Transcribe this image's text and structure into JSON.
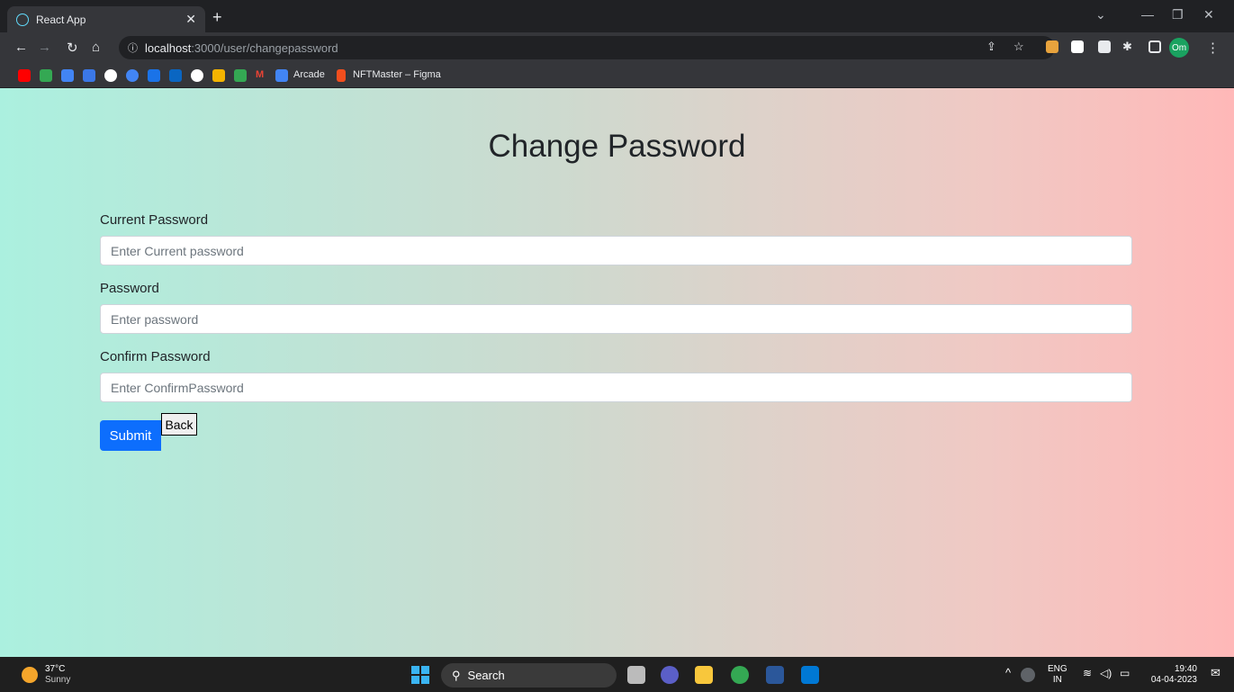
{
  "browser": {
    "tab_title": "React App",
    "url_host": "localhost",
    "url_path": ":3000/user/changepassword",
    "profile_initials": "Om",
    "bookmarks": [
      "Arcade",
      "NFTMaster – Figma"
    ]
  },
  "page": {
    "title": "Change Password",
    "current_label": "Current Password",
    "current_placeholder": "Enter Current password",
    "password_label": "Password",
    "password_placeholder": "Enter password",
    "confirm_label": "Confirm Password",
    "confirm_placeholder": "Enter ConfirmPassword",
    "submit_label": "Submit",
    "back_label": "Back"
  },
  "taskbar": {
    "temperature": "37°C",
    "weather": "Sunny",
    "search_label": "Search",
    "lang": "ENG",
    "region": "IN",
    "time": "19:40",
    "date": "04-04-2023"
  },
  "colors": {
    "primary": "#0d6efd",
    "gradient_left": "#abf0df",
    "gradient_right": "#ffb8b8"
  }
}
